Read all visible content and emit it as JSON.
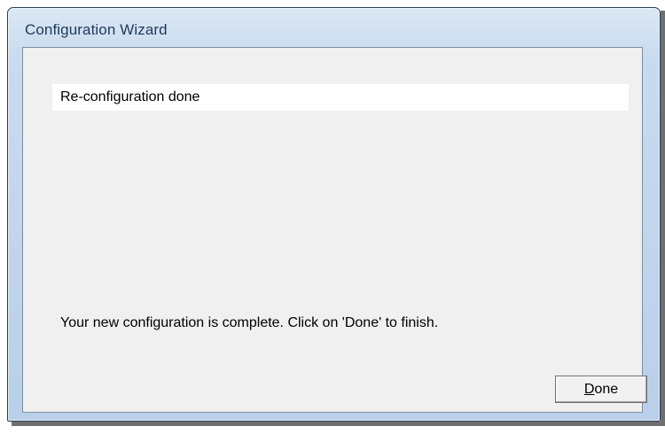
{
  "window": {
    "title": "Configuration Wizard"
  },
  "status": {
    "text": "Re-configuration done"
  },
  "message": {
    "text": "Your new configuration is complete.  Click on 'Done' to finish."
  },
  "buttons": {
    "done": {
      "mnemonic": "D",
      "rest": "one"
    }
  }
}
